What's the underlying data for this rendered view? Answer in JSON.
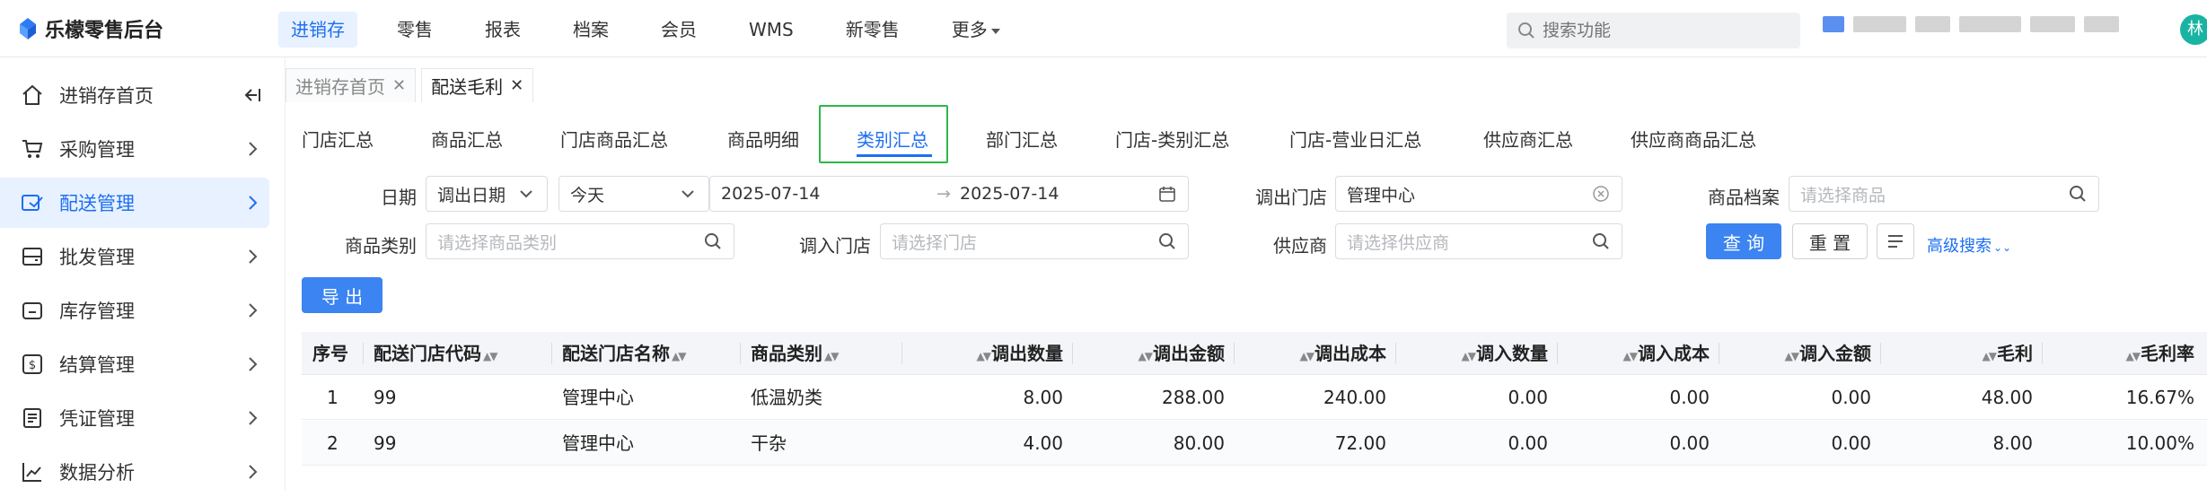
{
  "app": {
    "title": "乐檬零售后台"
  },
  "topnav": [
    {
      "label": "进销存",
      "active": true
    },
    {
      "label": "零售"
    },
    {
      "label": "报表"
    },
    {
      "label": "档案"
    },
    {
      "label": "会员"
    },
    {
      "label": "WMS"
    },
    {
      "label": "新零售"
    },
    {
      "label": "更多"
    }
  ],
  "search": {
    "placeholder": "搜索功能"
  },
  "user": {
    "avatar_text": "林"
  },
  "sidebar": {
    "items": [
      {
        "label": "进销存首页",
        "icon": "home-icon",
        "suffix": "collapse-icon"
      },
      {
        "label": "采购管理",
        "icon": "cart-icon"
      },
      {
        "label": "配送管理",
        "icon": "delivery-icon",
        "active": true
      },
      {
        "label": "批发管理",
        "icon": "wholesale-icon"
      },
      {
        "label": "库存管理",
        "icon": "inventory-icon"
      },
      {
        "label": "结算管理",
        "icon": "settlement-icon"
      },
      {
        "label": "凭证管理",
        "icon": "voucher-icon"
      },
      {
        "label": "数据分析",
        "icon": "chart-icon"
      }
    ]
  },
  "pagetabs": [
    {
      "label": "进销存首页"
    },
    {
      "label": "配送毛利",
      "active": true
    }
  ],
  "reporttabs": [
    {
      "label": "门店汇总"
    },
    {
      "label": "商品汇总"
    },
    {
      "label": "门店商品汇总"
    },
    {
      "label": "商品明细"
    },
    {
      "label": "类别汇总",
      "active": true
    },
    {
      "label": "部门汇总"
    },
    {
      "label": "门店-类别汇总"
    },
    {
      "label": "门店-营业日汇总"
    },
    {
      "label": "供应商汇总"
    },
    {
      "label": "供应商商品汇总"
    }
  ],
  "filters": {
    "date_label": "日期",
    "date_type": "调出日期",
    "date_range": "今天",
    "date_start": "2025-07-14",
    "date_end": "2025-07-14",
    "out_store_label": "调出门店",
    "out_store_value": "管理中心",
    "product_file_label": "商品档案",
    "product_file_placeholder": "请选择商品",
    "category_label": "商品类别",
    "category_placeholder": "请选择商品类别",
    "in_store_label": "调入门店",
    "in_store_placeholder": "请选择门店",
    "supplier_label": "供应商",
    "supplier_placeholder": "请选择供应商",
    "query_label": "查 询",
    "reset_label": "重 置",
    "advanced_label": "高级搜索",
    "export_label": "导 出"
  },
  "table": {
    "headers": [
      "序号",
      "配送门店代码",
      "配送门店名称",
      "商品类别",
      "调出数量",
      "调出金额",
      "调出成本",
      "调入数量",
      "调入成本",
      "调入金额",
      "毛利",
      "毛利率"
    ],
    "rows": [
      [
        "1",
        "99",
        "管理中心",
        "低温奶类",
        "8.00",
        "288.00",
        "240.00",
        "0.00",
        "0.00",
        "0.00",
        "48.00",
        "16.67%"
      ],
      [
        "2",
        "99",
        "管理中心",
        "干杂",
        "4.00",
        "80.00",
        "72.00",
        "0.00",
        "0.00",
        "0.00",
        "8.00",
        "10.00%"
      ]
    ]
  },
  "colors": {
    "accent": "#1e6ff0",
    "primary_button": "#3b84f1",
    "highlight_box": "#2fb64b"
  }
}
